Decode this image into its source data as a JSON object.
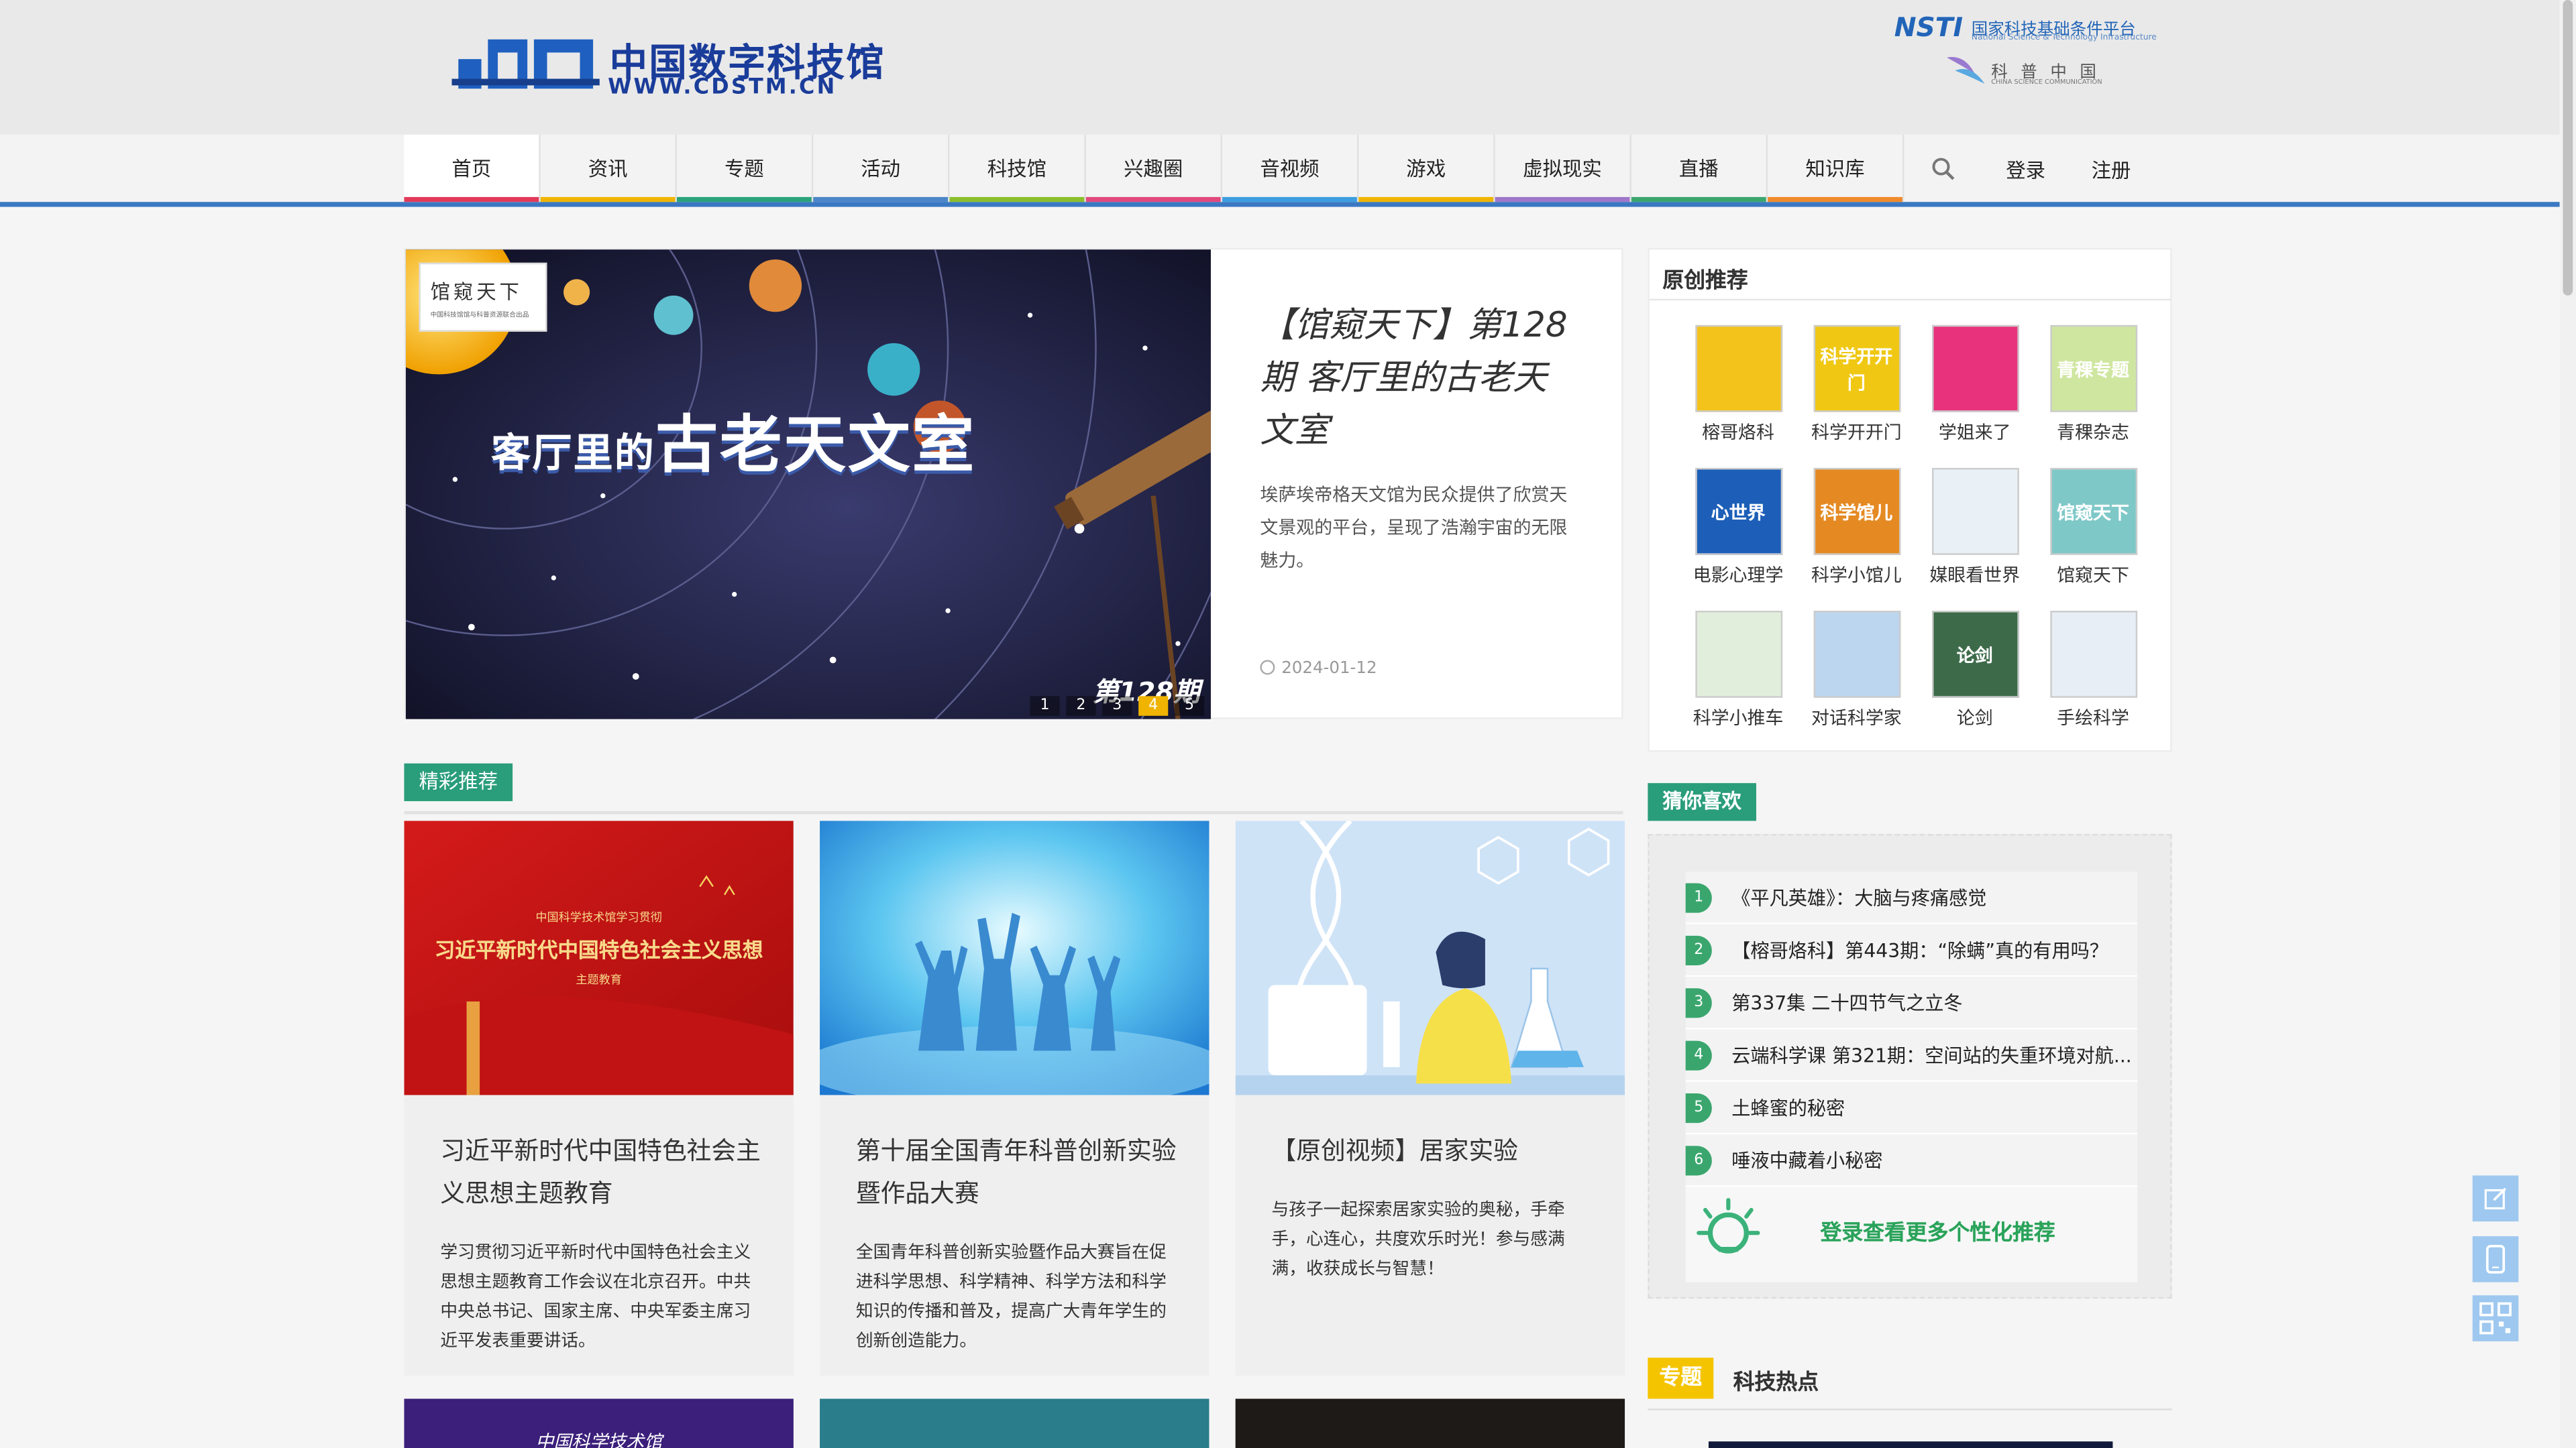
{
  "header": {
    "logo_cn": "中国数字科技馆",
    "logo_en": "WWW.CDSTM.CN",
    "partner1_logo": "NSTI",
    "partner1_cn": "国家科技基础条件平台",
    "partner1_en": "National Science & Technology Infrastructure",
    "partner2_cn": "科普中国",
    "partner2_en": "CHINA SCIENCE COMMUNICATION"
  },
  "nav": {
    "items": [
      {
        "label": "首页",
        "color": "#e23a5a"
      },
      {
        "label": "资讯",
        "color": "#f0b400"
      },
      {
        "label": "专题",
        "color": "#2aa37a"
      },
      {
        "label": "活动",
        "color": "#4b86c8"
      },
      {
        "label": "科技馆",
        "color": "#8bbe2b"
      },
      {
        "label": "兴趣圈",
        "color": "#e2487d"
      },
      {
        "label": "音视频",
        "color": "#3c9ee0"
      },
      {
        "label": "游戏",
        "color": "#f0b400"
      },
      {
        "label": "虚拟现实",
        "color": "#9e77c9"
      },
      {
        "label": "直播",
        "color": "#3aa66e"
      },
      {
        "label": "知识库",
        "color": "#f08a2a"
      }
    ],
    "search_icon": "search-icon",
    "login": "登录",
    "register": "注册"
  },
  "feature": {
    "badge": "馆窥天下",
    "badge_sub": "中国科技馆馆与科普资源联合出品",
    "image_title_small": "客厅里的",
    "image_title_big": "古老天文室",
    "issue": "第128期",
    "dots": [
      "1",
      "2",
      "3",
      "4",
      "5"
    ],
    "active_dot": 4,
    "title": "【馆窥天下】第128期 客厅里的古老天文室",
    "desc": "埃萨埃帝格天文馆为民众提供了欣赏天文景观的平台，呈现了浩瀚宇宙的无限魅力。",
    "date": "2024-01-12"
  },
  "original": {
    "title": "原创推荐",
    "items": [
      {
        "label": "榕哥烙科",
        "bg": "#f3c21b",
        "icon": "glasses-face-icon",
        "text": ""
      },
      {
        "label": "科学开开门",
        "bg": "#f0c814",
        "icon": "science-door-icon",
        "text": "科学开开门"
      },
      {
        "label": "学姐来了",
        "bg": "#e8337c",
        "icon": "girl-silhouette-icon",
        "text": ""
      },
      {
        "label": "青稞杂志",
        "bg": "#cfe6a0",
        "icon": "barley-icon",
        "text": "青稞专题"
      },
      {
        "label": "电影心理学",
        "bg": "#1d5fb8",
        "icon": "film-icon",
        "text": "心世界"
      },
      {
        "label": "科学小馆儿",
        "bg": "#e58a23",
        "icon": "teapot-icon",
        "text": "科学馆儿"
      },
      {
        "label": "媒眼看世界",
        "bg": "#e9f1f7",
        "icon": "eye-icon",
        "text": ""
      },
      {
        "label": "馆窥天下",
        "bg": "#7fc8c8",
        "icon": "telescope-icon",
        "text": "馆窥天下"
      },
      {
        "label": "科学小推车",
        "bg": "#e2eedc",
        "icon": "cart-icon",
        "text": ""
      },
      {
        "label": "对话科学家",
        "bg": "#bcd6ef",
        "icon": "scientist-icon",
        "text": ""
      },
      {
        "label": "论剑",
        "bg": "#3d6b4a",
        "icon": "sword-icon",
        "text": "论剑"
      },
      {
        "label": "手绘科学",
        "bg": "#e7eef5",
        "icon": "pencil-drawing-icon",
        "text": ""
      }
    ]
  },
  "highlights": {
    "tag": "精彩推荐",
    "cards": [
      {
        "title": "习近平新时代中国特色社会主义思想主题教育",
        "desc": "学习贯彻习近平新时代中国特色社会主义思想主题教育工作会议在北京召开。中共中央总书记、国家主席、中央军委主席习近平发表重要讲话。",
        "img_line1": "中国科学技术馆学习贯彻",
        "img_line2": "习近平新时代中国特色社会主义思想",
        "img_line3": "主题教育"
      },
      {
        "title": "第十届全国青年科普创新实验暨作品大赛",
        "desc": "全国青年科普创新实验暨作品大赛旨在促进科学思想、科学精神、科学方法和科学知识的传播和普及，提高广大青年学生的创新创造能力。"
      },
      {
        "title": "【原创视频】居家实验",
        "desc": "与孩子一起探索居家实验的奥秘，手牵手，心连心，共度欢乐时光！参与感满满，收获成长与智慧！"
      }
    ],
    "bottom_caption": "中国科学技术馆"
  },
  "guess": {
    "tag": "猜你喜欢",
    "items": [
      "《平凡英雄》：大脑与疼痛感觉",
      "【榕哥烙科】第443期：“除螨”真的有用吗？",
      "第337集 二十四节气之立冬",
      "云端科学课 第321期：空间站的失重环境对航...",
      "土蜂蜜的秘密",
      "唾液中藏着小秘密"
    ],
    "login_text": "登录查看更多个性化推荐"
  },
  "hot": {
    "tag": "专题",
    "label": "科技热点"
  },
  "side_tools": [
    "edit-icon",
    "mobile-icon",
    "qrcode-icon"
  ]
}
